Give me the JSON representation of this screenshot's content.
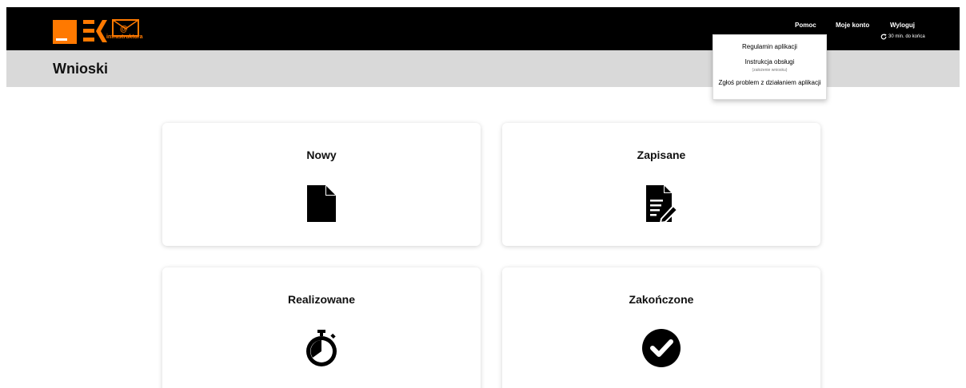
{
  "header": {
    "logo_text": "infrastruktura",
    "nav": {
      "help": "Pomoc",
      "account": "Moje konto",
      "logout": "Wyloguj"
    },
    "session_timer": "30 min. do końca",
    "colors": {
      "bar": "#000000",
      "brand": "#ff7900"
    }
  },
  "page": {
    "title": "Wnioski"
  },
  "help_menu": {
    "items": [
      {
        "label": "Regulamin aplikacji"
      },
      {
        "label": "Instrukcja obsługi",
        "sublabel": "(założenie wniosku)"
      },
      {
        "label": "Zgłoś problem z działaniem aplikacji"
      }
    ]
  },
  "cards": [
    {
      "title": "Nowy",
      "icon": "file-icon"
    },
    {
      "title": "Zapisane",
      "icon": "file-signature-icon"
    },
    {
      "title": "Realizowane",
      "icon": "stopwatch-icon"
    },
    {
      "title": "Zakończone",
      "icon": "check-circle-icon"
    }
  ]
}
